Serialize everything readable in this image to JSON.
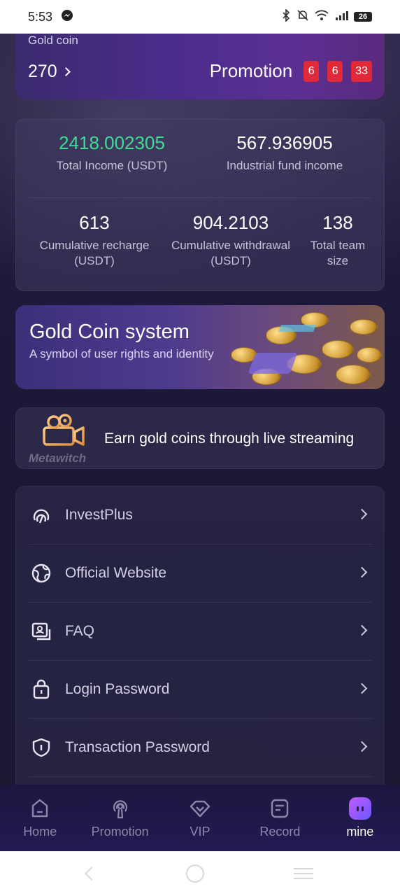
{
  "status_bar": {
    "time": "5:53",
    "battery": "26",
    "icons": [
      "messenger-icon",
      "bluetooth-icon",
      "mute-icon",
      "wifi-icon",
      "signal-icon",
      "battery-icon"
    ]
  },
  "gold_coin": {
    "label": "Gold coin",
    "count": "270",
    "promotion_label": "Promotion",
    "timer": [
      "6",
      "6",
      "33"
    ]
  },
  "stats": {
    "total_income_value": "2418.002305",
    "total_income_label": "Total Income (USDT)",
    "industrial_fund_value": "567.936905",
    "industrial_fund_label": "Industrial fund income",
    "recharge_value": "613",
    "recharge_label_1": "Cumulative recharge",
    "recharge_label_2": "(USDT)",
    "withdrawal_value": "904.2103",
    "withdrawal_label_1": "Cumulative withdrawal",
    "withdrawal_label_2": "(USDT)",
    "team_value": "138",
    "team_label_1": "Total team",
    "team_label_2": "size"
  },
  "banner": {
    "title": "Gold Coin system",
    "subtitle": "A symbol of user rights and identity"
  },
  "stream_card": {
    "brand": "Metawitch",
    "text": "Earn gold coins through live streaming"
  },
  "menu": [
    {
      "label": "InvestPlus",
      "icon": "investplus-icon"
    },
    {
      "label": "Official Website",
      "icon": "globe-icon"
    },
    {
      "label": "FAQ",
      "icon": "faq-icon"
    },
    {
      "label": "Login Password",
      "icon": "lock-icon"
    },
    {
      "label": "Transaction Password",
      "icon": "shield-icon"
    }
  ],
  "tabs": [
    {
      "label": "Home",
      "icon": "home-icon"
    },
    {
      "label": "Promotion",
      "icon": "broadcast-icon"
    },
    {
      "label": "VIP",
      "icon": "diamond-icon"
    },
    {
      "label": "Record",
      "icon": "record-icon"
    },
    {
      "label": "mine",
      "icon": "mine-icon",
      "active": true
    }
  ],
  "colors": {
    "accent_green": "#3fdc95",
    "timer_red": "#e02a3a",
    "background": "#1c1838"
  }
}
